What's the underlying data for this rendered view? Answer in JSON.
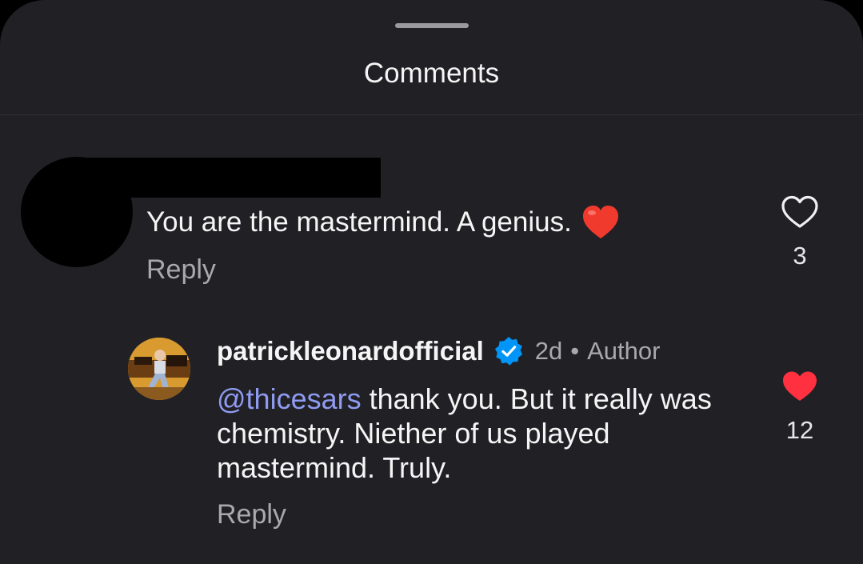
{
  "sheet": {
    "title": "Comments"
  },
  "comments": [
    {
      "text": "You are the mastermind. A genius.",
      "emoji": "red-heart",
      "reply_label": "Reply",
      "like_count": "3",
      "liked": false
    },
    {
      "username": "patrickleonardofficial",
      "verified": true,
      "time": "2d",
      "separator": "•",
      "role": "Author",
      "mention": "@thicesars",
      "text": " thank you. But it really was chemistry. Niether of us played mastermind. Truly.",
      "reply_label": "Reply",
      "like_count": "12",
      "liked": true
    }
  ],
  "colors": {
    "background": "#212125",
    "text": "#f5f5f5",
    "secondary_text": "#a8a8ad",
    "mention": "#8f9bf2",
    "like_red": "#ff3040",
    "verified_blue": "#0095f6"
  }
}
